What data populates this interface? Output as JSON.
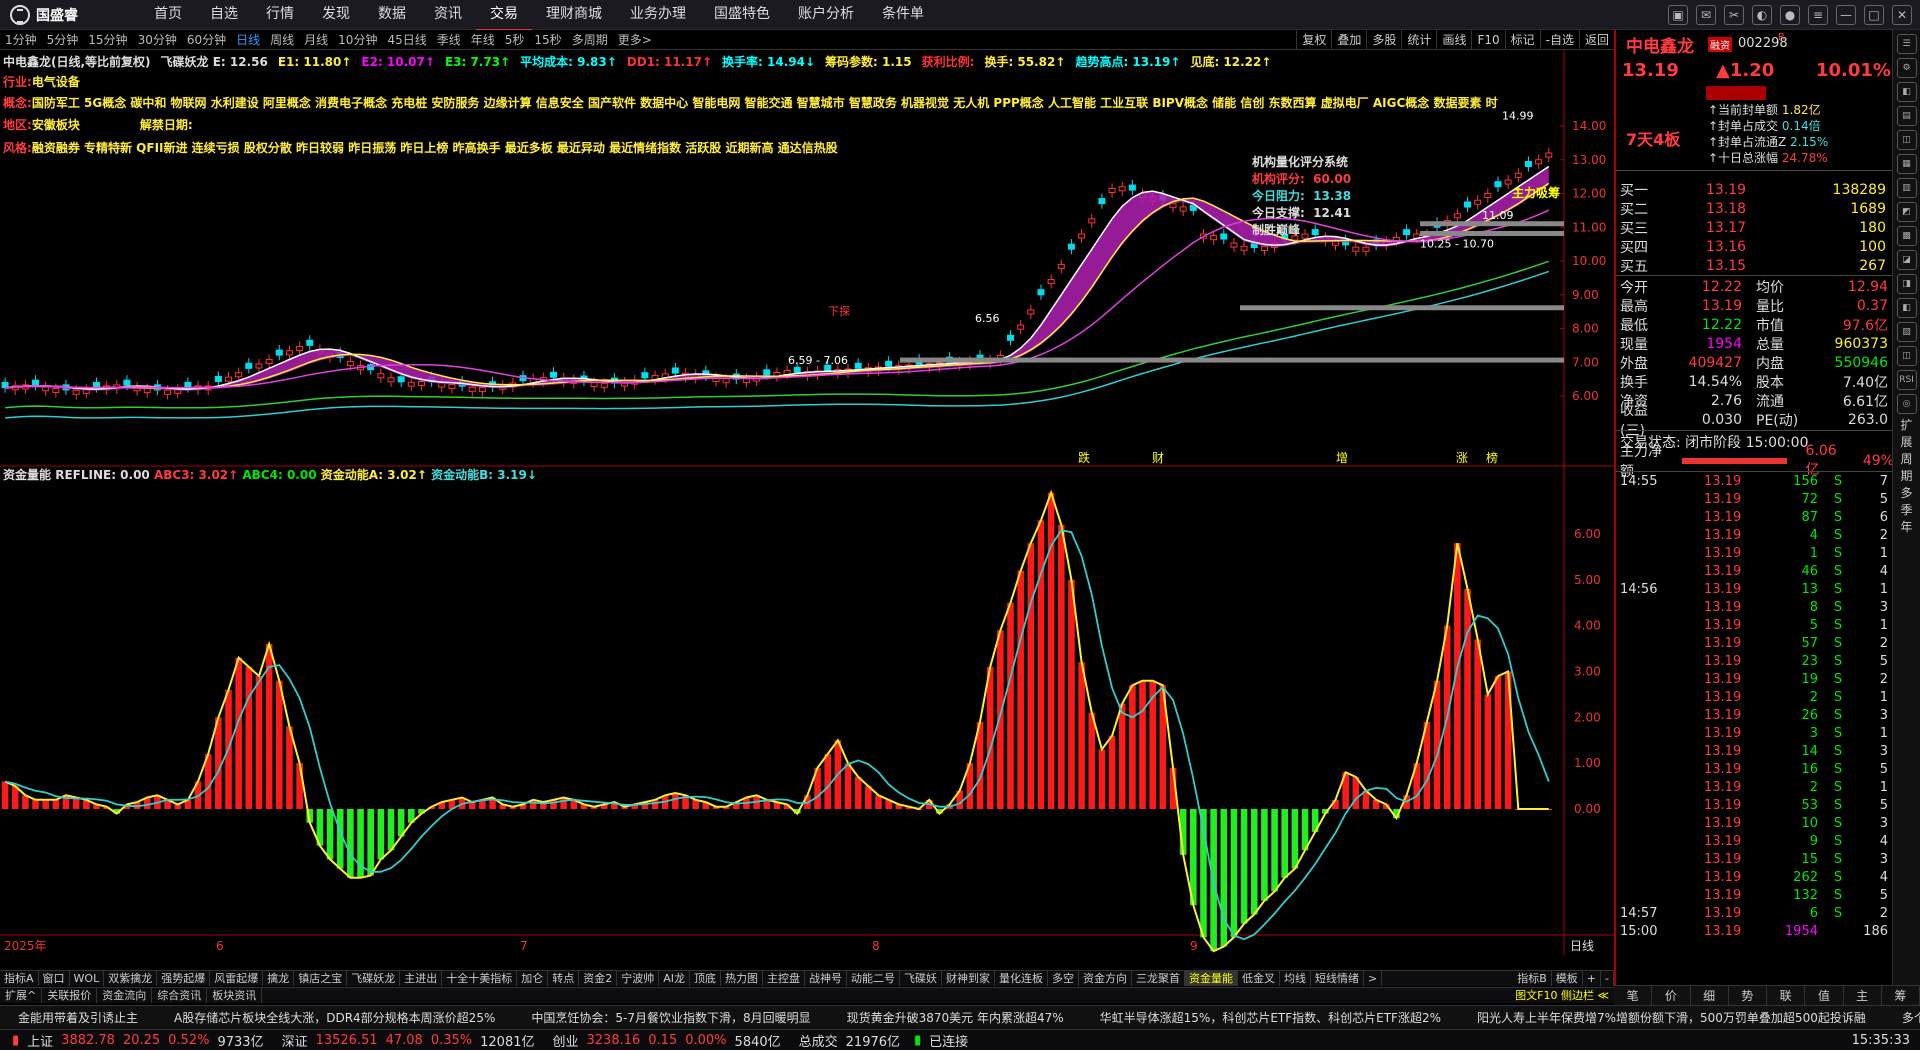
{
  "app": {
    "logo_text": "国盛睿"
  },
  "menu": [
    "首页",
    "自选",
    "行情",
    "发现",
    "数据",
    "资讯",
    "交易",
    "理财商城",
    "业务办理",
    "国盛特色",
    "账户分析",
    "条件单"
  ],
  "periods": [
    "1分钟",
    "5分钟",
    "15分钟",
    "30分钟",
    "60分钟",
    "日线",
    "周线",
    "月线",
    "10分钟",
    "45日线",
    "季线",
    "年线",
    "5秒",
    "15秒",
    "多周期",
    "更多>"
  ],
  "period_selected": "日线",
  "chart_tools": [
    "复权",
    "叠加",
    "多股",
    "统计",
    "画线",
    "F10",
    "标记",
    "-自选",
    "返回"
  ],
  "stock": {
    "name": "中电鑫龙",
    "code": "002298",
    "tag": "融资",
    "price": "13.19",
    "change": "▲1.20",
    "pct": "10.01%",
    "board": "7天4板"
  },
  "info": {
    "line1": [
      {
        "t": "中电鑫龙(日线,等比前复权)",
        "c": "#ddd"
      },
      {
        "t": "飞碟妖龙 E: 12.56",
        "c": "#ddd"
      },
      {
        "t": "E1: 11.80↑",
        "c": "#ffeb3b"
      },
      {
        "t": "E2: 10.07↑",
        "c": "#f0f"
      },
      {
        "t": "E3: 7.73↑",
        "c": "#0f0"
      },
      {
        "t": "平均成本: 9.83↑",
        "c": "#0ff"
      },
      {
        "t": "DD1: 11.17↑",
        "c": "#f33"
      },
      {
        "t": "换手率: 14.94↓",
        "c": "#0ff"
      },
      {
        "t": "筹码参数: 1.15",
        "c": "#ffeb3b"
      },
      {
        "t": "获利比例:",
        "c": "#f33"
      },
      {
        "t": "换手: 55.82↑",
        "c": "#ffeb3b"
      },
      {
        "t": "趋势高点: 13.19↑",
        "c": "#0ff"
      },
      {
        "t": "见底: 12.22↑",
        "c": "#ffeb3b"
      }
    ],
    "industry_label": "行业:",
    "industry": "电气设备",
    "concept_label": "概念:",
    "concepts": "国防军工 5G概念 碳中和 物联网 水利建设 阿里概念 消费电子概念 充电桩 安防服务 边缘计算 信息安全 国产软件 数据中心 智能电网 智能交通 智慧城市 智慧政务 机器视觉 无人机 PPP概念 人工智能 工业互联 BIPV概念 储能 信创 东数西算 虚拟电厂 AIGC概念 数据要素 时",
    "region_label": "地区:",
    "region": "安徽板块",
    "unlock_label": "解禁日期:",
    "style_label": "风格:",
    "styles": "融资融券 专精特新 QFII新进 连续亏损 股权分散 昨日较弱 昨日振荡 昨日上榜 昨高换手 最近多板 最近异动 最近情绪指数 活跃股 近期新高 通达信热股"
  },
  "rating": {
    "title": "机构量化评分系统",
    "score_label": "机构评分:",
    "score": "60.00",
    "res_label": "今日阻力:",
    "res": "13.38",
    "sup_label": "今日支撑:",
    "sup": "12.41",
    "win": "制胜巅峰"
  },
  "price_annotations": {
    "high": "14.99",
    "mid1": "10.25 - 10.70",
    "mid2": "11.09",
    "low1": "6.56",
    "low2": "6.59 - 7.06",
    "main": "主力吸筹",
    "xiaban": "下探",
    "up_a": "跌",
    "up_b": "财",
    "up_c": "增",
    "up_d": "涨",
    "up_e": "榜"
  },
  "y_axis_main": [
    "14.00",
    "13.00",
    "12.00",
    "11.00",
    "10.00",
    "9.00",
    "8.00",
    "7.00",
    "6.00"
  ],
  "indicator": {
    "name": "资金量能",
    "refline": "REFLINE: 0.00",
    "abc3": "ABC3: 3.02↑",
    "abc4": "ABC4: 0.00",
    "a": "资金动能A: 3.02↑",
    "b": "资金动能B: 3.19↓"
  },
  "y_axis_ind": [
    "6.00",
    "5.00",
    "4.00",
    "3.00",
    "2.00",
    "1.00",
    "0.00"
  ],
  "x_axis": {
    "year": "2025年",
    "m6": "6",
    "m7": "7",
    "m8": "8",
    "m9": "9",
    "right": "日线"
  },
  "chart_data": {
    "type": "bar",
    "title": "资金量能",
    "x": [
      1,
      2,
      3,
      4,
      5,
      6,
      7,
      8,
      9,
      10,
      11,
      12,
      13,
      14,
      15,
      16,
      17,
      18,
      19,
      20,
      21,
      22,
      23,
      24,
      25,
      26,
      27,
      28,
      29,
      30,
      31,
      32,
      33,
      34,
      35,
      36,
      37,
      38,
      39,
      40,
      41,
      42,
      43,
      44,
      45,
      46,
      47,
      48,
      49,
      50,
      51,
      52,
      53,
      54,
      55,
      56,
      57,
      58,
      59,
      60,
      61,
      62,
      63,
      64,
      65,
      66,
      67,
      68,
      69,
      70,
      71,
      72,
      73,
      74,
      75,
      76,
      77,
      78,
      79,
      80,
      81,
      82,
      83,
      84,
      85,
      86,
      87,
      88,
      89,
      90,
      91,
      92,
      93,
      94,
      95,
      96,
      97,
      98,
      99,
      100,
      101,
      102,
      103,
      104,
      105,
      106,
      107,
      108,
      109,
      110,
      111,
      112,
      113,
      114,
      115,
      116,
      117,
      118,
      119,
      120,
      121,
      122,
      123,
      124,
      125,
      126,
      127,
      128,
      129,
      130,
      131,
      132,
      133,
      134,
      135,
      136,
      137,
      138,
      139,
      140,
      141,
      142,
      143,
      144,
      145,
      146,
      147,
      148,
      149,
      150,
      151,
      152,
      153
    ],
    "values": [
      0.6,
      0.5,
      0.3,
      0.2,
      0.2,
      0.2,
      0.3,
      0.25,
      0.2,
      0.1,
      0.05,
      -0.1,
      0.1,
      0.15,
      0.25,
      0.3,
      0.2,
      0.1,
      0.2,
      0.6,
      1.2,
      2.0,
      2.6,
      3.3,
      3.1,
      2.9,
      3.6,
      2.8,
      1.8,
      1.0,
      -0.3,
      -0.8,
      -1.1,
      -1.3,
      -1.5,
      -1.5,
      -1.45,
      -1.1,
      -0.9,
      -0.6,
      -0.3,
      -0.1,
      0.05,
      0.15,
      0.2,
      0.25,
      0.15,
      0.2,
      0.25,
      0.1,
      0.05,
      0.1,
      0.2,
      0.15,
      0.2,
      0.25,
      0.2,
      0.1,
      0.05,
      0.1,
      0.15,
      0.05,
      0.1,
      0.15,
      0.2,
      0.3,
      0.35,
      0.3,
      0.2,
      0.15,
      0.05,
      0.05,
      0.15,
      0.25,
      0.3,
      0.2,
      0.15,
      0.1,
      -0.1,
      0.3,
      0.9,
      1.2,
      1.5,
      1.0,
      0.7,
      0.5,
      0.3,
      0.2,
      0.1,
      0.05,
      0.0,
      0.2,
      -0.1,
      0.1,
      0.4,
      1.0,
      1.9,
      3.1,
      3.9,
      4.5,
      5.2,
      5.8,
      6.3,
      6.9,
      6.2,
      5.0,
      3.2,
      2.1,
      1.3,
      1.6,
      2.3,
      2.7,
      2.8,
      2.8,
      2.7,
      0.9,
      -1.0,
      -2.1,
      -2.8,
      -3.1,
      -3.0,
      -2.8,
      -2.5,
      -2.3,
      -2.0,
      -1.8,
      -1.5,
      -1.3,
      -0.9,
      -0.5,
      -0.1,
      0.2,
      0.8,
      0.7,
      0.4,
      0.2,
      0.1,
      -0.2,
      0.3,
      1.0,
      1.9,
      2.8,
      4.0,
      5.8,
      4.8,
      3.7,
      2.5,
      2.9,
      3.0,
      0.0,
      0.0,
      0.0,
      0.0
    ],
    "ylim": [
      -3.2,
      7.0
    ]
  },
  "right": {
    "stats": [
      {
        "k": "当前封单额",
        "v": "1.82亿"
      },
      {
        "k": "封单占成交",
        "v": "0.14倍"
      },
      {
        "k": "封单占流通Z",
        "v": "2.15%"
      },
      {
        "k": "十日总涨幅",
        "v": "24.78%"
      }
    ],
    "sells": [
      {
        "l": "卖五",
        "p": "",
        "v": ""
      },
      {
        "l": "卖四",
        "p": "",
        "v": ""
      },
      {
        "l": "卖三",
        "p": "",
        "v": ""
      },
      {
        "l": "卖二",
        "p": "",
        "v": ""
      },
      {
        "l": "卖一",
        "p": "",
        "v": ""
      }
    ],
    "buys": [
      {
        "l": "买一",
        "p": "13.19",
        "v": "138289"
      },
      {
        "l": "买二",
        "p": "13.18",
        "v": "1689"
      },
      {
        "l": "买三",
        "p": "13.17",
        "v": "180"
      },
      {
        "l": "买四",
        "p": "13.16",
        "v": "100"
      },
      {
        "l": "买五",
        "p": "13.15",
        "v": "267"
      }
    ],
    "quote": [
      [
        "今开",
        "12.22",
        "均价",
        "12.94"
      ],
      [
        "最高",
        "13.19",
        "量比",
        "0.37"
      ],
      [
        "最低",
        "12.22",
        "市值",
        "97.6亿"
      ],
      [
        "现量",
        "1954",
        "总量",
        "960373"
      ],
      [
        "外盘",
        "409427",
        "内盘",
        "550946"
      ],
      [
        "换手",
        "14.54%",
        "股本",
        "7.40亿"
      ],
      [
        "净资",
        "2.76",
        "流通",
        "6.61亿"
      ],
      [
        "收益(三)",
        "0.030",
        "PE(动)",
        "263.0"
      ]
    ],
    "status": "交易状态: 闭市阶段 15:00:00",
    "main_net_label": "主力净额",
    "main_net": "6.06亿",
    "main_net_pct": "49%",
    "ticks": [
      {
        "t": "14:55",
        "p": "13.19",
        "v": "156",
        "d": "S",
        "n": "7"
      },
      {
        "t": "",
        "p": "13.19",
        "v": "72",
        "d": "S",
        "n": "5"
      },
      {
        "t": "",
        "p": "13.19",
        "v": "87",
        "d": "S",
        "n": "6"
      },
      {
        "t": "",
        "p": "13.19",
        "v": "4",
        "d": "S",
        "n": "2"
      },
      {
        "t": "",
        "p": "13.19",
        "v": "1",
        "d": "S",
        "n": "1"
      },
      {
        "t": "",
        "p": "13.19",
        "v": "46",
        "d": "S",
        "n": "4"
      },
      {
        "t": "14:56",
        "p": "13.19",
        "v": "13",
        "d": "S",
        "n": "1"
      },
      {
        "t": "",
        "p": "13.19",
        "v": "8",
        "d": "S",
        "n": "3"
      },
      {
        "t": "",
        "p": "13.19",
        "v": "5",
        "d": "S",
        "n": "1"
      },
      {
        "t": "",
        "p": "13.19",
        "v": "57",
        "d": "S",
        "n": "2"
      },
      {
        "t": "",
        "p": "13.19",
        "v": "23",
        "d": "S",
        "n": "5"
      },
      {
        "t": "",
        "p": "13.19",
        "v": "19",
        "d": "S",
        "n": "2"
      },
      {
        "t": "",
        "p": "13.19",
        "v": "2",
        "d": "S",
        "n": "1"
      },
      {
        "t": "",
        "p": "13.19",
        "v": "26",
        "d": "S",
        "n": "3"
      },
      {
        "t": "",
        "p": "13.19",
        "v": "3",
        "d": "S",
        "n": "1"
      },
      {
        "t": "",
        "p": "13.19",
        "v": "14",
        "d": "S",
        "n": "3"
      },
      {
        "t": "",
        "p": "13.19",
        "v": "16",
        "d": "S",
        "n": "5"
      },
      {
        "t": "",
        "p": "13.19",
        "v": "2",
        "d": "S",
        "n": "1"
      },
      {
        "t": "",
        "p": "13.19",
        "v": "53",
        "d": "S",
        "n": "5"
      },
      {
        "t": "",
        "p": "13.19",
        "v": "10",
        "d": "S",
        "n": "3"
      },
      {
        "t": "",
        "p": "13.19",
        "v": "9",
        "d": "S",
        "n": "4"
      },
      {
        "t": "",
        "p": "13.19",
        "v": "15",
        "d": "S",
        "n": "3"
      },
      {
        "t": "",
        "p": "13.19",
        "v": "262",
        "d": "S",
        "n": "4"
      },
      {
        "t": "",
        "p": "13.19",
        "v": "132",
        "d": "S",
        "n": "5"
      },
      {
        "t": "14:57",
        "p": "13.19",
        "v": "6",
        "d": "S",
        "n": "2"
      },
      {
        "t": "15:00",
        "p": "13.19",
        "v": "1954",
        "d": "",
        "n": "186"
      }
    ]
  },
  "right_tabs": [
    "笔",
    "价",
    "细",
    "势",
    "联",
    "值",
    "主",
    "筹"
  ],
  "right_side_icons": [
    "☰",
    "⚙",
    "◧",
    "▤",
    "◫",
    "▦",
    "▥",
    "◩",
    "▩",
    "◪",
    "◨",
    "◧",
    "▨",
    "◫",
    "RSI",
    "◎"
  ],
  "right_vertical_text": "扩展周期多季年",
  "indicator_tabs": [
    "指标A",
    "窗口",
    "WOL",
    "双紫擒龙",
    "强势起爆",
    "风雷起爆",
    "擒龙",
    "镇店之宝",
    "飞碟妖龙",
    "主进出",
    "十全十美指标",
    "加仑",
    "转点",
    "资金2",
    "宁波帅",
    "AI龙",
    "顶底",
    "热力图",
    "主控盘",
    "战神号",
    "动能二号",
    "飞碟妖",
    "财神到家",
    "量化连板",
    "多空",
    "资金方向",
    "三龙聚首",
    "资金量能",
    "低金叉",
    "均线",
    "短线情绪",
    ">"
  ],
  "indicator_tabs_right": [
    "指标B",
    "模板",
    "+",
    "-"
  ],
  "bottom_tabs2": [
    "扩展^",
    "关联报价",
    "资金流向",
    "综合资讯",
    "板块资讯"
  ],
  "bottom_right_tag": "图文F10 侧边栏 ≪",
  "news": [
    "金能用带着及引诱止主",
    "A股存储芯片板块全线大涨，DDR4部分规格本周涨价超25%",
    "中国烹饪协会：5-7月餐饮业指数下滑，8月回暖明显",
    "现货黄金升破3870美元 年内累涨超47%",
    "华虹半导体涨超15%，科创芯片ETF指数、科创芯片ETF涨超2%",
    "阳光人寿上半年保费增7%增额份额下滑，500万罚单叠加超500起投诉融",
    "多个新茶饮品牌"
  ],
  "statusbar": {
    "sh_label": "上证",
    "sh": "3882.78",
    "sh_ch": "20.25",
    "sh_pct": "0.52%",
    "sh_amt": "9733亿",
    "sz_label": "深证",
    "sz": "13526.51",
    "sz_ch": "47.08",
    "sz_pct": "0.35%",
    "sz_amt": "12081亿",
    "cy_label": "创业",
    "cy": "3238.16",
    "cy_ch": "0.15",
    "cy_pct": "0.00%",
    "cy_amt": "5840亿",
    "total_label": "总成交",
    "total": "21976亿",
    "conn": "已连接",
    "time": "15:35:33"
  }
}
